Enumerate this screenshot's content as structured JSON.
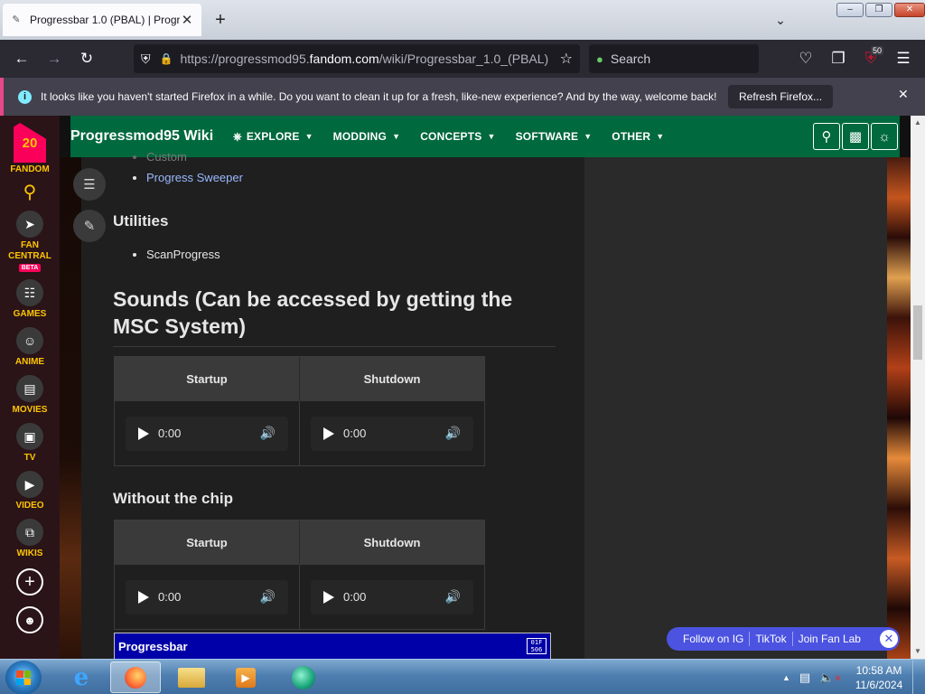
{
  "browser": {
    "tab_title": "Progressbar 1.0 (PBAL) | Progre",
    "url_prefix": "https://progressmod95.",
    "url_domain": "fandom.com",
    "url_path": "/wiki/Progressbar_1.0_(PBAL)",
    "search_placeholder": "Search",
    "notification_badge": "50"
  },
  "notification": {
    "message": "It looks like you haven't started Firefox in a while. Do you want to clean it up for a fresh, like-new experience? And by the way, welcome back!",
    "button_label": "Refresh Firefox..."
  },
  "rail": {
    "logo_number": "20",
    "fandom_label": "FANDOM",
    "items": [
      {
        "label": "FAN CENTRAL",
        "icon": "rocket-icon",
        "badge": "BETA"
      },
      {
        "label": "GAMES",
        "icon": "gamepad-icon"
      },
      {
        "label": "ANIME",
        "icon": "anime-icon"
      },
      {
        "label": "MOVIES",
        "icon": "movie-icon"
      },
      {
        "label": "TV",
        "icon": "tv-icon"
      },
      {
        "label": "VIDEO",
        "icon": "video-icon"
      },
      {
        "label": "WIKIS",
        "icon": "book-icon"
      }
    ]
  },
  "wiki_header": {
    "title": "Progressmod95 Wiki",
    "nav": [
      "EXPLORE",
      "MODDING",
      "CONCEPTS",
      "SOFTWARE",
      "OTHER"
    ]
  },
  "article": {
    "top_items": [
      "Custom",
      "Progress Sweeper"
    ],
    "utilities_heading": "Utilities",
    "utilities_items": [
      "ScanProgress"
    ],
    "sounds_heading": "Sounds (Can be accessed by getting the MSC System)",
    "chip_heading": "Without the chip",
    "table_headers": [
      "Startup",
      "Shutdown"
    ],
    "player_time": "0:00",
    "progressbar_window_title": "Progressbar",
    "progressbar_window_icon": "01F 506"
  },
  "follow_bar": {
    "items": [
      "Follow on IG",
      "TikTok",
      "Join Fan Lab"
    ]
  },
  "taskbar": {
    "time": "10:58 AM",
    "date": "11/6/2024"
  },
  "colors": {
    "fandom_green": "#00693e",
    "fandom_pink": "#fa005a",
    "fandom_yellow": "#ffc500",
    "link_blue": "#9ab8ff"
  }
}
